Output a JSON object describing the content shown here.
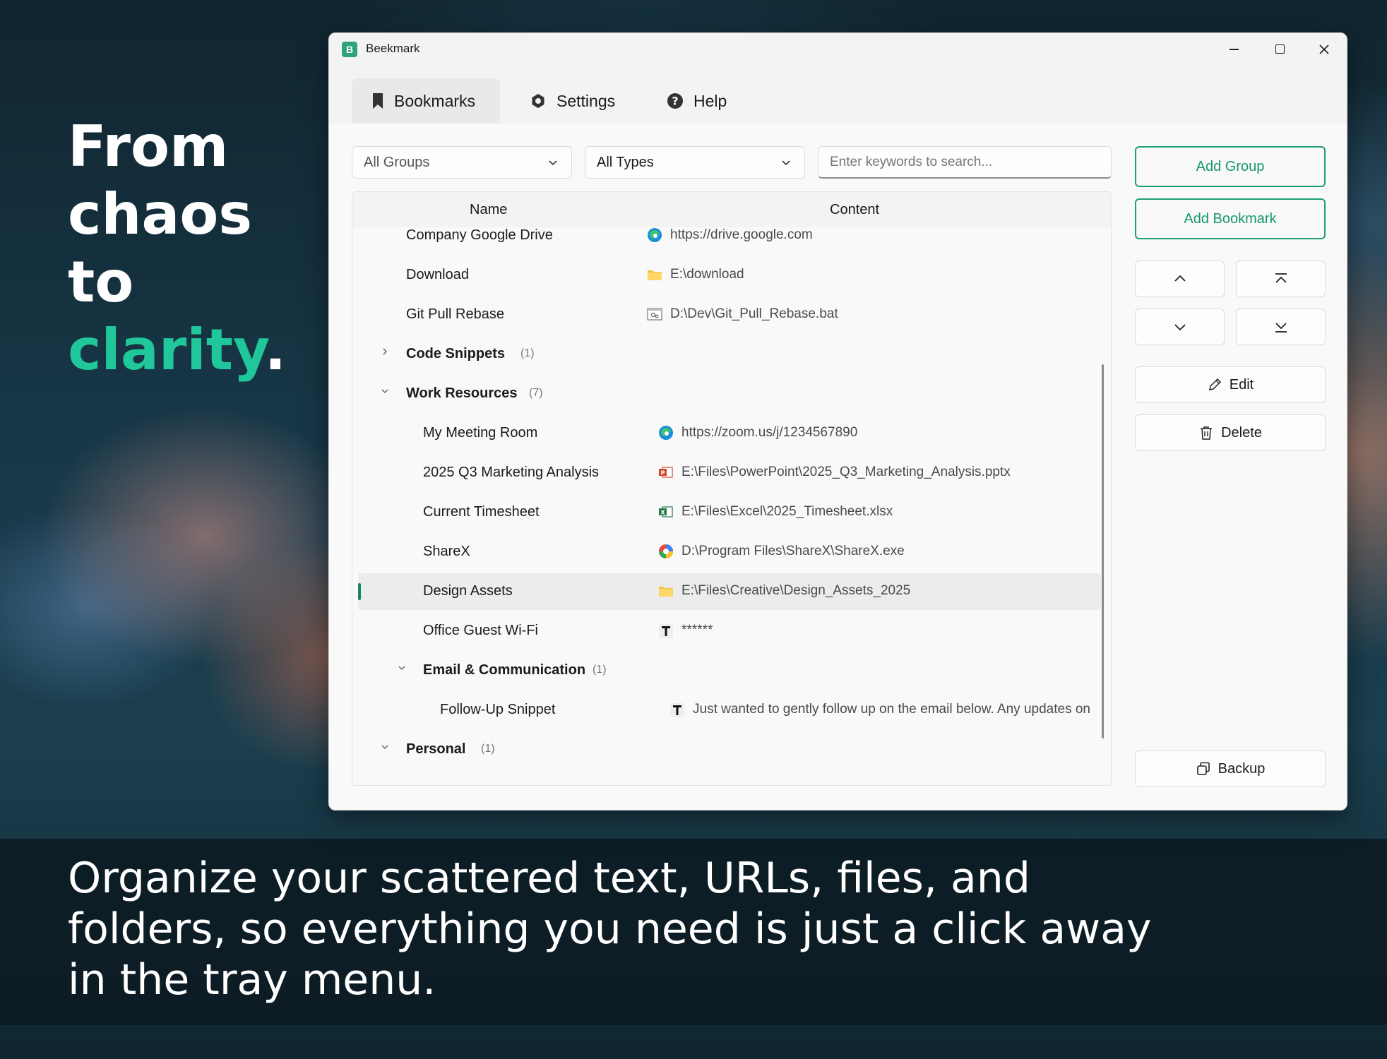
{
  "marketing": {
    "headline_line1": "From",
    "headline_line2": "chaos",
    "headline_line3": "to",
    "headline_accent": "clarity",
    "headline_period": ".",
    "tagline": "Organize your scattered text, URLs, files, and folders, so everything you need is just a click away in the tray menu.",
    "accent_color": "#1fc79a"
  },
  "window": {
    "title": "Beekmark",
    "app_icon_letter": "B",
    "controls": [
      "minimize",
      "maximize",
      "close"
    ]
  },
  "tabs": [
    {
      "label": "Bookmarks",
      "icon": "bookmark-icon",
      "active": true
    },
    {
      "label": "Settings",
      "icon": "gear-icon",
      "active": false
    },
    {
      "label": "Help",
      "icon": "help-icon",
      "active": false
    }
  ],
  "filters": {
    "group": "All Groups",
    "type": "All Types",
    "search_placeholder": "Enter keywords to search..."
  },
  "list": {
    "columns": [
      "Name",
      "Content"
    ],
    "rows": [
      {
        "kind": "item",
        "level": 0,
        "name": "Company Google Drive",
        "icon": "edge-icon",
        "content": "https://drive.google.com"
      },
      {
        "kind": "item",
        "level": 0,
        "name": "Download",
        "icon": "folder-icon",
        "content": "E:\\download"
      },
      {
        "kind": "item",
        "level": 0,
        "name": "Git Pull Rebase",
        "icon": "script-file-icon",
        "content": "D:\\Dev\\Git_Pull_Rebase.bat"
      },
      {
        "kind": "group",
        "level": 0,
        "name": "Code Snippets",
        "count": "(1)",
        "expanded": false
      },
      {
        "kind": "group",
        "level": 0,
        "name": "Work Resources",
        "count": "(7)",
        "expanded": true
      },
      {
        "kind": "item",
        "level": 1,
        "name": "My Meeting Room",
        "icon": "edge-icon",
        "content": "https://zoom.us/j/1234567890"
      },
      {
        "kind": "item",
        "level": 1,
        "name": "2025 Q3 Marketing Analysis",
        "icon": "powerpoint-icon",
        "content": "E:\\Files\\PowerPoint\\2025_Q3_Marketing_Analysis.pptx"
      },
      {
        "kind": "item",
        "level": 1,
        "name": "Current Timesheet",
        "icon": "excel-icon",
        "content": "E:\\Files\\Excel\\2025_Timesheet.xlsx"
      },
      {
        "kind": "item",
        "level": 1,
        "name": "ShareX",
        "icon": "sharex-icon",
        "content": "D:\\Program Files\\ShareX\\ShareX.exe"
      },
      {
        "kind": "item",
        "level": 1,
        "name": "Design Assets",
        "icon": "folder-icon",
        "content": "E:\\Files\\Creative\\Design_Assets_2025",
        "selected": true
      },
      {
        "kind": "item",
        "level": 1,
        "name": "Office Guest Wi-Fi",
        "icon": "text-icon",
        "content": "******"
      },
      {
        "kind": "group",
        "level": 1,
        "name": "Email & Communication",
        "count": "(1)",
        "expanded": true
      },
      {
        "kind": "item",
        "level": 2,
        "name": "Follow-Up Snippet",
        "icon": "text-icon",
        "content": "Just wanted to gently follow up on the email below. Any updates on y"
      },
      {
        "kind": "group",
        "level": 0,
        "name": "Personal",
        "count": "(1)",
        "expanded": true
      }
    ]
  },
  "actions": {
    "add_group": "Add Group",
    "add_bookmark": "Add Bookmark",
    "edit": "Edit",
    "delete": "Delete",
    "backup": "Backup"
  },
  "colors": {
    "accent": "#1f9e7c",
    "selection_bar": "#14866b"
  }
}
